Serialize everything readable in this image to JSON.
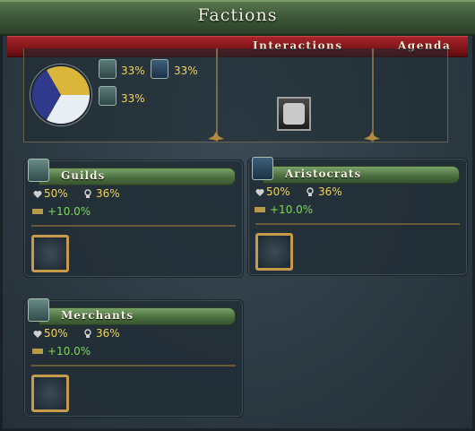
{
  "window": {
    "title": "Factions"
  },
  "ribbon": {
    "interactions_label": "Interactions",
    "agenda_label": "Agenda"
  },
  "overview": {
    "pie": [
      {
        "faction": "Guilds",
        "share": 33,
        "color": "#e8eef4"
      },
      {
        "faction": "Aristocrats",
        "share": 33,
        "color": "#2f3a8c"
      },
      {
        "faction": "Merchants",
        "share": 33,
        "color": "#d9b53a"
      }
    ],
    "shares": {
      "guilds": "33%",
      "aristocrats": "33%",
      "merchants": "33%"
    },
    "interaction_icon": "scroll-seal-icon"
  },
  "factions": [
    {
      "name": "Guilds",
      "icon": "guild-anvil-icon",
      "approval": "50%",
      "influence": "36%",
      "modifier": "+10.0%",
      "agenda_slot": "empty"
    },
    {
      "name": "Aristocrats",
      "icon": "aristocrat-hat-icon",
      "approval": "50%",
      "influence": "36%",
      "modifier": "+10.0%",
      "agenda_slot": "empty"
    },
    {
      "name": "Merchants",
      "icon": "merchant-scales-icon",
      "approval": "50%",
      "influence": "36%",
      "modifier": "+10.0%",
      "agenda_slot": "empty"
    }
  ],
  "colors": {
    "accent_gold": "#f0d35e",
    "positive_green": "#7ed957",
    "ribbon_red": "#8b1a1f",
    "banner_green": "#4a6d3e"
  }
}
